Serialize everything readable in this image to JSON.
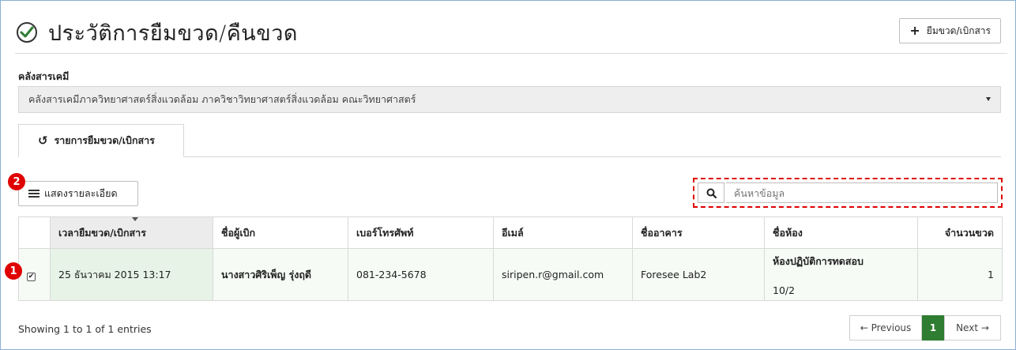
{
  "header": {
    "title": "ประวัติการยืมขวด/คืนขวด",
    "add_button": "ยืมขวด/เบิกสาร"
  },
  "store": {
    "label": "คลังสารเคมี",
    "selected": "คลังสารเคมีภาควิทยาศาสตร์สิ่งแวดล้อม ภาควิชาวิทยาศาสตร์สิ่งแวดล้อม คณะวิทยาศาสตร์"
  },
  "tab": {
    "label": "รายการยืมขวด/เบิกสาร"
  },
  "toolbar": {
    "detail_button": "แสดงรายละเอียด",
    "search_placeholder": "ค้นหาข้อมูล"
  },
  "badges": [
    "1",
    "2"
  ],
  "table": {
    "headers": [
      "เวลายืมขวด/เบิกสาร",
      "ชื่อผู้เบิก",
      "เบอร์โทรศัพท์",
      "อีเมล์",
      "ชื่ออาคาร",
      "ชื่อห้อง",
      "จำนวนขวด"
    ],
    "rows": [
      {
        "checked": true,
        "time": "25 ธันวาคม 2015 13:17",
        "name": "นางสาวศิริเพ็ญ รุ่งฤดี",
        "phone": "081-234-5678",
        "email": "siripen.r@gmail.com",
        "building": "Foresee Lab2",
        "room_line1": "ห้องปฏิบัติการทดสอบ",
        "room_line2": "10/2",
        "count": "1"
      }
    ]
  },
  "footer": {
    "entries": "Showing 1 to 1 of 1 entries",
    "prev": "← Previous",
    "page": "1",
    "next": "Next →"
  },
  "colors": {
    "accent": "#2e7d32",
    "annotation": "#e00000"
  }
}
